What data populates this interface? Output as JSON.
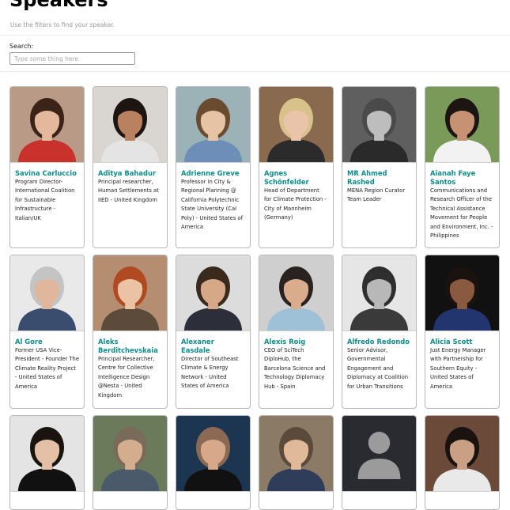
{
  "header": {
    "title": "Speakers",
    "subtitle": "Use the filters to find your speaker."
  },
  "search": {
    "label": "Search:",
    "placeholder": "Type some thing here",
    "value": ""
  },
  "colors": {
    "accent": "#0e8c8c",
    "card_border": "#b8b8b8"
  },
  "speakers": [
    {
      "name": "Savina Carluccio",
      "desc": "Program Director- International Coalition for Sustainable Infrastructure - Italian/UK",
      "photo": {
        "bg": "#b89a86",
        "hair": "#3b2417",
        "skin": "#e3b89c",
        "shirt": "#c8312c"
      }
    },
    {
      "name": "Aditya Bahadur",
      "desc": "Principal researcher, Human Settlements at IIED - United Kingdom",
      "photo": {
        "bg": "#d9d6d2",
        "hair": "#1d1512",
        "skin": "#b98160",
        "shirt": "#e4e4e4"
      }
    },
    {
      "name": "Adrienne Greve",
      "desc": "Professor in City & Regional Planning @ California Polytechnic State University (Cal Poly) - United States of America",
      "photo": {
        "bg": "#9bb2b7",
        "hair": "#6a4b2f",
        "skin": "#e7c3a5",
        "shirt": "#6d8fb7"
      }
    },
    {
      "name": "Agnes Schönfelder",
      "desc": "Head of Department for Climate Protection - City of Mannheim (Germany)",
      "photo": {
        "bg": "#8a6a4e",
        "hair": "#d9c18b",
        "skin": "#e9c4aa",
        "shirt": "#2b2b2b"
      }
    },
    {
      "name": "MR Ahmed Rashed",
      "desc": "MENA Region Curator Team Leader",
      "photo": {
        "bg": "#5f5f5f",
        "hair": "#4a4a4a",
        "skin": "#bdbdbd",
        "shirt": "#2a2a2a"
      }
    },
    {
      "name": "Aianah Faye Santos",
      "desc": "Communications and Research Officer of the Technical Assistance Movement for People and Environment, Inc. - Philippines",
      "photo": {
        "bg": "#7a9a5a",
        "hair": "#1d1512",
        "skin": "#c79274",
        "shirt": "#f2f2f2"
      }
    },
    {
      "name": "Al Gore",
      "desc": "Former USA Vice-President - Founder The Climate Reality Project - United States of America",
      "photo": {
        "bg": "#e9e9e9",
        "hair": "#c4c4c4",
        "skin": "#e0b69c",
        "shirt": "#3a4d6e"
      }
    },
    {
      "name": "Aleks Berditchevskaia",
      "desc": "Principal Researcher, Centre for Collective Intelligence Design @Nesta - United Kingdom",
      "photo": {
        "bg": "#b58e72",
        "hair": "#b04a22",
        "skin": "#ebc2a4",
        "shirt": "#5c4a3a"
      }
    },
    {
      "name": "Alexaner Easdale",
      "desc": "Director of Southeast Climate & Energy Network - United States of America",
      "photo": {
        "bg": "#dcdcdc",
        "hair": "#3a2a1e",
        "skin": "#d7a888",
        "shirt": "#2c2f3a"
      }
    },
    {
      "name": "Alexis Roig",
      "desc": "CEO of SciTech DiploHub, the Barcelona Science and Technology Diplomacy Hub - Spain",
      "photo": {
        "bg": "#cfcfcf",
        "hair": "#2a2220",
        "skin": "#d9ac8d",
        "shirt": "#9ec1d8"
      }
    },
    {
      "name": "Alfredo Redondo",
      "desc": "Senior Advisor, Governmental Engagement and Diplomacy at Coalition for Urban Transitions",
      "photo": {
        "bg": "#e6e6e6",
        "hair": "#2e2e2e",
        "skin": "#b8b8b8",
        "shirt": "#3a3a3a"
      }
    },
    {
      "name": "Alicia Scott",
      "desc": "Just Energy Manager with Partnership for Southern Equity - United States of America",
      "photo": {
        "bg": "#111111",
        "hair": "#1a120e",
        "skin": "#8a5a40",
        "shirt": "#23356e"
      }
    },
    {
      "name": "",
      "desc": "",
      "photo": {
        "bg": "#e4e4e4",
        "hair": "#1a1410",
        "skin": "#e3c0a6",
        "shirt": "#111111"
      }
    },
    {
      "name": "",
      "desc": "",
      "photo": {
        "bg": "#6a7a5a",
        "hair": "#7a6a5a",
        "skin": "#d4ad8e",
        "shirt": "#4a5a6a"
      }
    },
    {
      "name": "",
      "desc": "",
      "photo": {
        "bg": "#1c3550",
        "hair": "#8a6a52",
        "skin": "#d7a88a",
        "shirt": "#111111"
      }
    },
    {
      "name": "",
      "desc": "",
      "photo": {
        "bg": "#8a7a66",
        "hair": "#5a4a3a",
        "skin": "#e0b89a",
        "shirt": "#2f3c5a"
      }
    },
    {
      "name": "",
      "desc": "",
      "photo": {
        "bg": "#2a2b30",
        "hair": "#9b9b9b",
        "skin": "#9b9b9b",
        "shirt": "#9b9b9b",
        "placeholder": true
      }
    },
    {
      "name": "",
      "desc": "",
      "photo": {
        "bg": "#6b4a3a",
        "hair": "#1a120e",
        "skin": "#caa084",
        "shirt": "#e9e9e9"
      }
    }
  ]
}
